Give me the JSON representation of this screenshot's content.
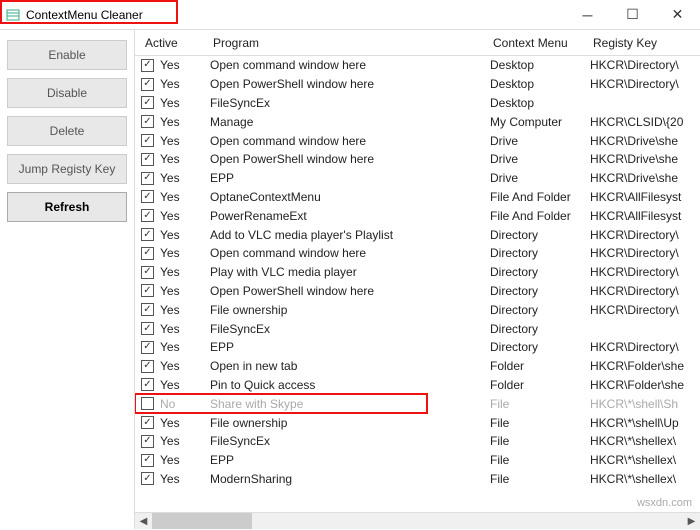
{
  "window": {
    "title": "ContextMenu Cleaner"
  },
  "sidebar": {
    "enable": "Enable",
    "disable": "Disable",
    "delete": "Delete",
    "jump": "Jump Registy Key",
    "refresh": "Refresh"
  },
  "columns": {
    "active": "Active",
    "program": "Program",
    "context": "Context Menu",
    "reg": "Registy Key"
  },
  "rows": [
    {
      "checked": true,
      "active": "Yes",
      "program": "Open command window here",
      "context": "Desktop",
      "reg": "HKCR\\Directory\\"
    },
    {
      "checked": true,
      "active": "Yes",
      "program": "Open PowerShell window here",
      "context": "Desktop",
      "reg": "HKCR\\Directory\\"
    },
    {
      "checked": true,
      "active": "Yes",
      "program": " FileSyncEx",
      "context": "Desktop",
      "reg": ""
    },
    {
      "checked": true,
      "active": "Yes",
      "program": "Manage",
      "context": "My Computer",
      "reg": "HKCR\\CLSID\\{20"
    },
    {
      "checked": true,
      "active": "Yes",
      "program": "Open command window here",
      "context": "Drive",
      "reg": "HKCR\\Drive\\she"
    },
    {
      "checked": true,
      "active": "Yes",
      "program": "Open PowerShell window here",
      "context": "Drive",
      "reg": "HKCR\\Drive\\she"
    },
    {
      "checked": true,
      "active": "Yes",
      "program": "EPP",
      "context": "Drive",
      "reg": "HKCR\\Drive\\she"
    },
    {
      "checked": true,
      "active": "Yes",
      "program": "OptaneContextMenu",
      "context": "File And Folder",
      "reg": "HKCR\\AllFilesyst"
    },
    {
      "checked": true,
      "active": "Yes",
      "program": "PowerRenameExt",
      "context": "File And Folder",
      "reg": "HKCR\\AllFilesyst"
    },
    {
      "checked": true,
      "active": "Yes",
      "program": "Add to VLC media player's Playlist",
      "context": "Directory",
      "reg": "HKCR\\Directory\\"
    },
    {
      "checked": true,
      "active": "Yes",
      "program": "Open command window here",
      "context": "Directory",
      "reg": "HKCR\\Directory\\"
    },
    {
      "checked": true,
      "active": "Yes",
      "program": "Play with VLC media player",
      "context": "Directory",
      "reg": "HKCR\\Directory\\"
    },
    {
      "checked": true,
      "active": "Yes",
      "program": "Open PowerShell window here",
      "context": "Directory",
      "reg": "HKCR\\Directory\\"
    },
    {
      "checked": true,
      "active": "Yes",
      "program": "File ownership",
      "context": "Directory",
      "reg": "HKCR\\Directory\\"
    },
    {
      "checked": true,
      "active": "Yes",
      "program": " FileSyncEx",
      "context": "Directory",
      "reg": ""
    },
    {
      "checked": true,
      "active": "Yes",
      "program": "EPP",
      "context": "Directory",
      "reg": "HKCR\\Directory\\"
    },
    {
      "checked": true,
      "active": "Yes",
      "program": "Open in new tab",
      "context": "Folder",
      "reg": "HKCR\\Folder\\she"
    },
    {
      "checked": true,
      "active": "Yes",
      "program": "Pin to Quick access",
      "context": "Folder",
      "reg": "HKCR\\Folder\\she"
    },
    {
      "checked": false,
      "active": "No",
      "program": "Share with Skype",
      "context": "File",
      "reg": "HKCR\\*\\shell\\Sh",
      "disabled": true
    },
    {
      "checked": true,
      "active": "Yes",
      "program": "File ownership",
      "context": "File",
      "reg": "HKCR\\*\\shell\\Up"
    },
    {
      "checked": true,
      "active": "Yes",
      "program": " FileSyncEx",
      "context": "File",
      "reg": "HKCR\\*\\shellex\\"
    },
    {
      "checked": true,
      "active": "Yes",
      "program": "EPP",
      "context": "File",
      "reg": "HKCR\\*\\shellex\\"
    },
    {
      "checked": true,
      "active": "Yes",
      "program": "ModernSharing",
      "context": "File",
      "reg": "HKCR\\*\\shellex\\"
    }
  ],
  "watermark": "wsxdn.com"
}
